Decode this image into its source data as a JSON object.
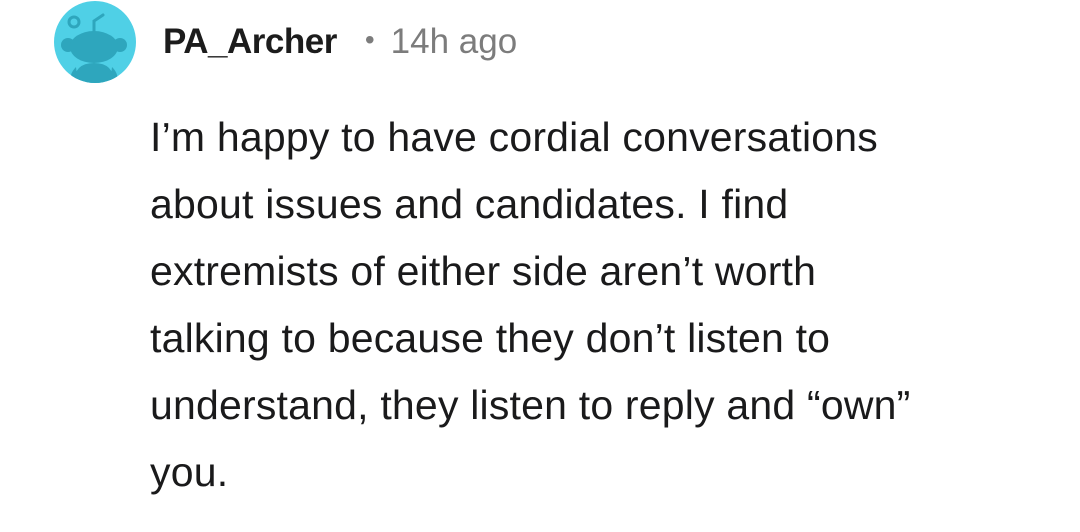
{
  "comment": {
    "author": "PA_Archer",
    "separator": "•",
    "timestamp": "14h ago",
    "body_lines": [
      "I’m happy to have cordial conversations",
      "about issues and candidates. I find",
      "extremists of either side aren’t worth",
      "talking to because they don’t listen to",
      "understand, they listen to reply and “own”",
      "you."
    ]
  },
  "colors": {
    "avatar_bg": "#4fd0e6",
    "avatar_figure": "#2ea6bd",
    "username": "#1c1c1c",
    "meta": "#7c7c7c",
    "text": "#1a1a1b"
  },
  "icons": {
    "avatar": "snoo-avatar-icon"
  }
}
